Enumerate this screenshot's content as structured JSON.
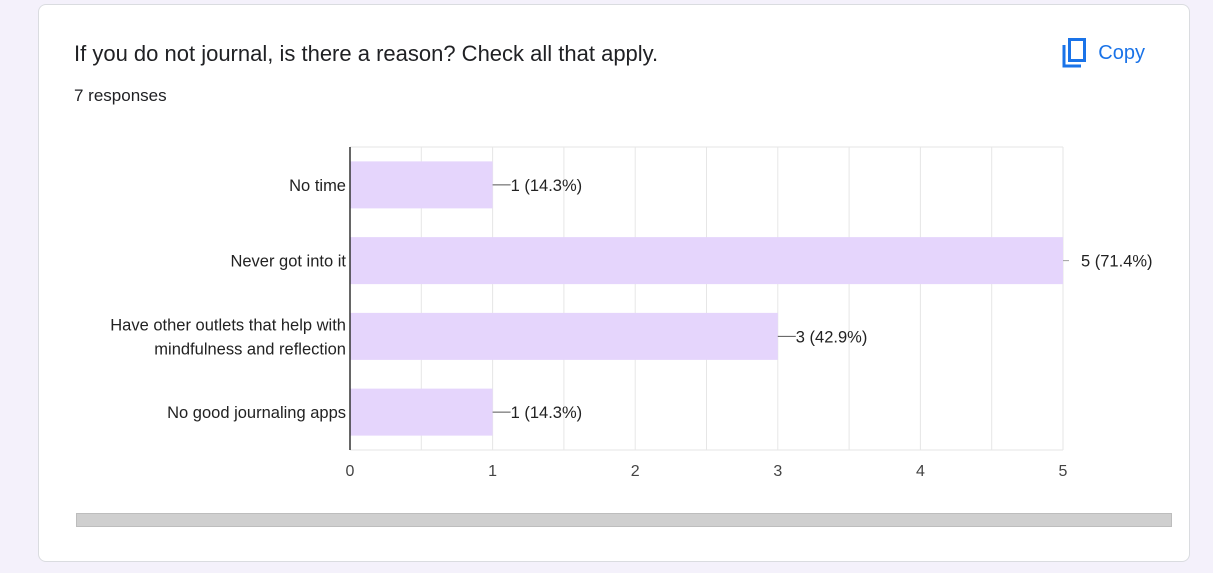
{
  "question": {
    "title": "If you do not journal, is there a reason? Check all that apply.",
    "responses": "7 responses"
  },
  "copy_button": {
    "label": "Copy",
    "icon": "copy-icon"
  },
  "colors": {
    "bar": "#e5d5fc",
    "accent": "#1a73e8",
    "grid": "#e6e6e6",
    "axis": "#333333"
  },
  "chart_data": {
    "type": "bar",
    "orientation": "horizontal",
    "categories": [
      [
        "No time"
      ],
      [
        "Never got into it"
      ],
      [
        "Have other outlets that help with",
        "mindfulness and reflection"
      ],
      [
        "No good journaling apps"
      ]
    ],
    "values": [
      1,
      5,
      3,
      1
    ],
    "data_labels": [
      "1 (14.3%)",
      "5 (71.4%)",
      "3 (42.9%)",
      "1 (14.3%)"
    ],
    "xlim": [
      0,
      5
    ],
    "xticks": [
      "0",
      "1",
      "2",
      "3",
      "4",
      "5"
    ],
    "grid": true
  }
}
